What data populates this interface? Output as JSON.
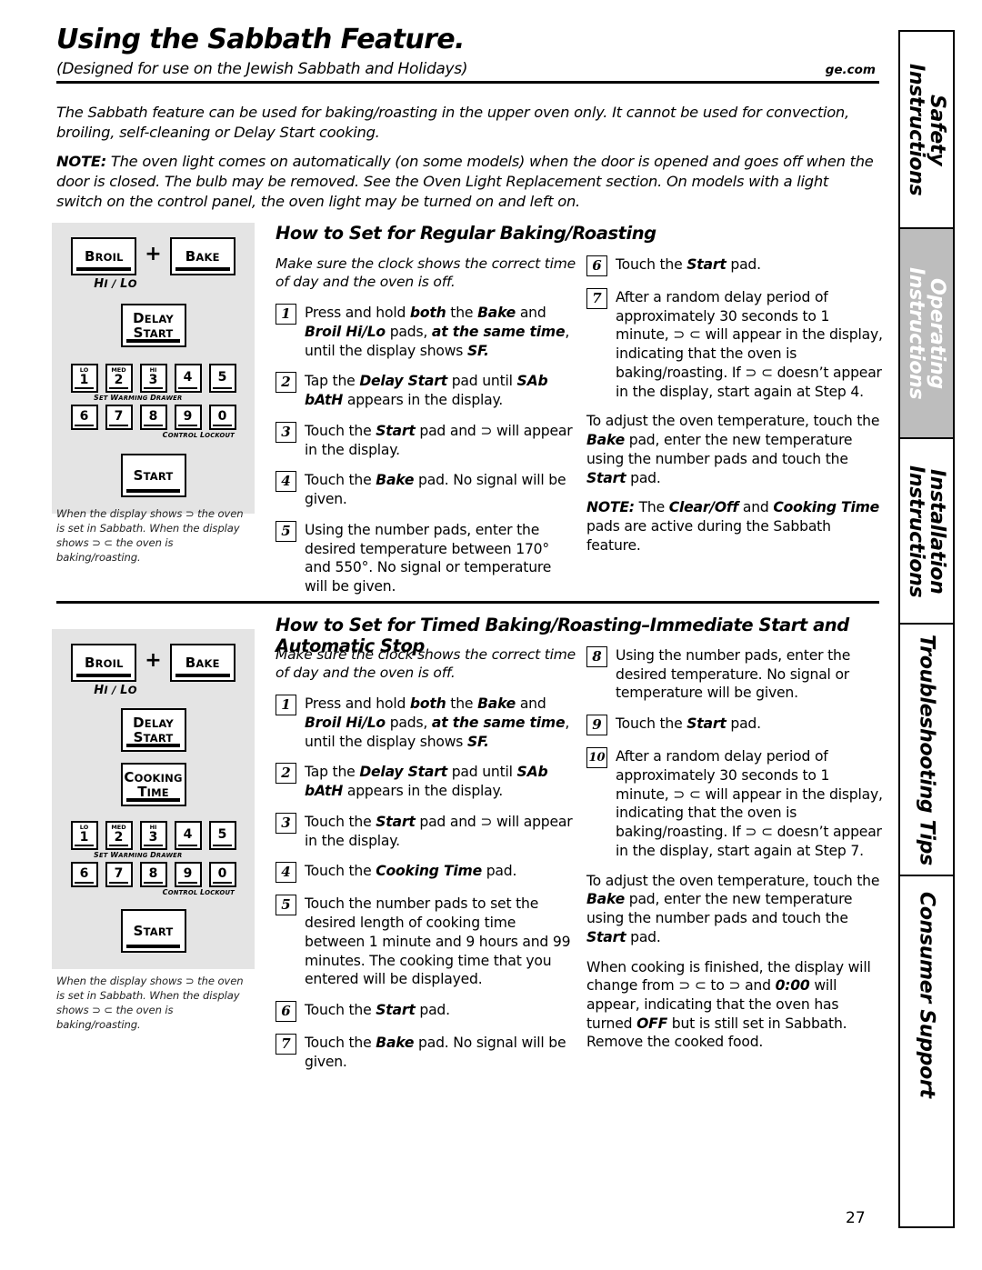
{
  "header": {
    "title": "Using the Sabbath Feature.",
    "subtitle": "(Designed for use on the Jewish Sabbath and Holidays)",
    "site": "ge.com"
  },
  "intro": {
    "paragraph1": "The Sabbath feature can be used for baking/roasting in the upper oven only. It cannot be used for convection, broiling, self-cleaning or Delay Start cooking.",
    "note_label": "NOTE:",
    "note_text": " The oven light comes on automatically (on some models) when the door is opened and goes off when the door is closed. The bulb may be removed. See the Oven Light Replacement section. On models with a light switch on the control panel, the oven light may be turned on and left on."
  },
  "panel1": {
    "broil": "Broil",
    "bake": "Bake",
    "plus": "+",
    "hilo": "Hi / Lo",
    "delay_start_line1": "Delay",
    "delay_start_line2": "Start",
    "start": "Start",
    "keys_row1": [
      {
        "top": "LO",
        "digit": "1"
      },
      {
        "top": "MED",
        "digit": "2"
      },
      {
        "top": "HI",
        "digit": "3"
      },
      {
        "top": "",
        "digit": "4"
      },
      {
        "top": "",
        "digit": "5"
      }
    ],
    "keys_row2": [
      {
        "top": "",
        "digit": "6"
      },
      {
        "top": "",
        "digit": "7"
      },
      {
        "top": "",
        "digit": "8"
      },
      {
        "top": "",
        "digit": "9"
      },
      {
        "top": "",
        "digit": "0"
      }
    ],
    "set_warming_drawer": "Set Warming Drawer",
    "control_lockout": "Control Lockout",
    "caption": "When the display shows ⊃ the oven is set in Sabbath. When the display shows ⊃ ⊂ the oven is baking/roasting."
  },
  "panel2": {
    "broil": "Broil",
    "bake": "Bake",
    "plus": "+",
    "hilo": "Hi / Lo",
    "delay_start_line1": "Delay",
    "delay_start_line2": "Start",
    "cooking_time_line1": "Cooking",
    "cooking_time_line2": "Time",
    "start": "Start",
    "set_warming_drawer": "Set Warming Drawer",
    "control_lockout": "Control Lockout",
    "caption": "When the display shows ⊃ the oven is set in Sabbath. When the display shows ⊃ ⊂ the oven is baking/roasting."
  },
  "section1": {
    "heading": "How to Set for Regular Baking/Roasting",
    "lead": "Make sure the clock shows the correct time of day and the oven is off.",
    "steps_left": [
      {
        "num": "1",
        "html": "Press and hold <span class=\"bi\">both</span> the <span class=\"bi\">Bake</span> and <span class=\"bi\">Broil Hi/Lo</span> pads, <span class=\"bi\">at the same time</span>, until the display shows <span class=\"bi\">SF.</span>"
      },
      {
        "num": "2",
        "html": "Tap the <span class=\"bi\">Delay Start</span> pad until <span class=\"bi\">SAb bAtH</span> appears in the display."
      },
      {
        "num": "3",
        "html": "Touch the <span class=\"bi\">Start</span> pad and ⊃ will appear in the display."
      },
      {
        "num": "4",
        "html": "Touch the <span class=\"bi\">Bake</span> pad. No signal will be given."
      },
      {
        "num": "5",
        "html": "Using the number pads, enter the desired temperature between 170° and 550°. No signal or temperature will be given."
      }
    ],
    "steps_right": [
      {
        "num": "6",
        "html": "Touch the <span class=\"bi\">Start</span> pad."
      },
      {
        "num": "7",
        "html": "After a random delay period of approximately 30 seconds to 1 minute, ⊃ ⊂ will appear in the display, indicating that the oven is baking/roasting. If ⊃ ⊂ doesn’t appear in the display, start again at Step 4."
      }
    ],
    "para_adjust": "To adjust the oven temperature, touch the <span class=\"bi\">Bake</span> pad, enter the new temperature using the number pads and touch the <span class=\"bi\">Start</span> pad.",
    "para_note": "<span class=\"bi\">NOTE:</span> The <span class=\"bi\">Clear/Off</span> and <span class=\"bi\">Cooking Time</span> pads are active during the Sabbath feature."
  },
  "section2": {
    "heading": "How to Set for Timed Baking/Roasting–Immediate Start and Automatic Stop",
    "lead": "Make sure the clock shows the correct time of day and the oven is off.",
    "steps_left": [
      {
        "num": "1",
        "html": "Press and hold <span class=\"bi\">both</span> the <span class=\"bi\">Bake</span> and <span class=\"bi\">Broil Hi/Lo</span> pads, <span class=\"bi\">at the same time</span>, until the display shows <span class=\"bi\">SF.</span>"
      },
      {
        "num": "2",
        "html": "Tap the <span class=\"bi\">Delay Start</span> pad until <span class=\"bi\">SAb bAtH</span> appears in the display."
      },
      {
        "num": "3",
        "html": "Touch the <span class=\"bi\">Start</span> pad and ⊃ will appear in the display."
      },
      {
        "num": "4",
        "html": "Touch the <span class=\"bi\">Cooking Time</span> pad."
      },
      {
        "num": "5",
        "html": "Touch the number pads to set the desired length of cooking time between 1 minute and 9 hours and 99 minutes. The cooking time that you entered will be displayed."
      },
      {
        "num": "6",
        "html": "Touch the <span class=\"bi\">Start</span> pad."
      },
      {
        "num": "7",
        "html": "Touch the <span class=\"bi\">Bake</span> pad. No signal will be given."
      }
    ],
    "steps_right": [
      {
        "num": "8",
        "html": "Using the number pads, enter the desired temperature. No signal or temperature will be given."
      },
      {
        "num": "9",
        "html": "Touch the <span class=\"bi\">Start</span> pad."
      },
      {
        "num": "10",
        "html": "After a random delay period of approximately 30 seconds to 1 minute, ⊃ ⊂ will appear in the display, indicating that the oven is baking/roasting. If ⊃ ⊂ doesn’t appear in the display, start again at Step 7."
      }
    ],
    "para_adjust": "To adjust the oven temperature, touch the <span class=\"bi\">Bake</span> pad, enter the new temperature using the number pads and touch the <span class=\"bi\">Start</span> pad.",
    "para_finish": "When cooking is finished, the display will change from ⊃ ⊂ to ⊃ and <span class=\"bi\">0:00</span> will appear, indicating that the oven has turned <span class=\"bi\">OFF</span> but is still set in Sabbath. Remove the cooked food."
  },
  "sidebar": {
    "tabs": [
      {
        "label": "Safety Instructions",
        "active": false
      },
      {
        "label": "Operating Instructions",
        "active": true
      },
      {
        "label": "Installation\nInstructions",
        "active": false
      },
      {
        "label": "Troubleshooting Tips",
        "active": false
      },
      {
        "label": "Consumer Support",
        "active": false
      }
    ]
  },
  "page_number": "27"
}
